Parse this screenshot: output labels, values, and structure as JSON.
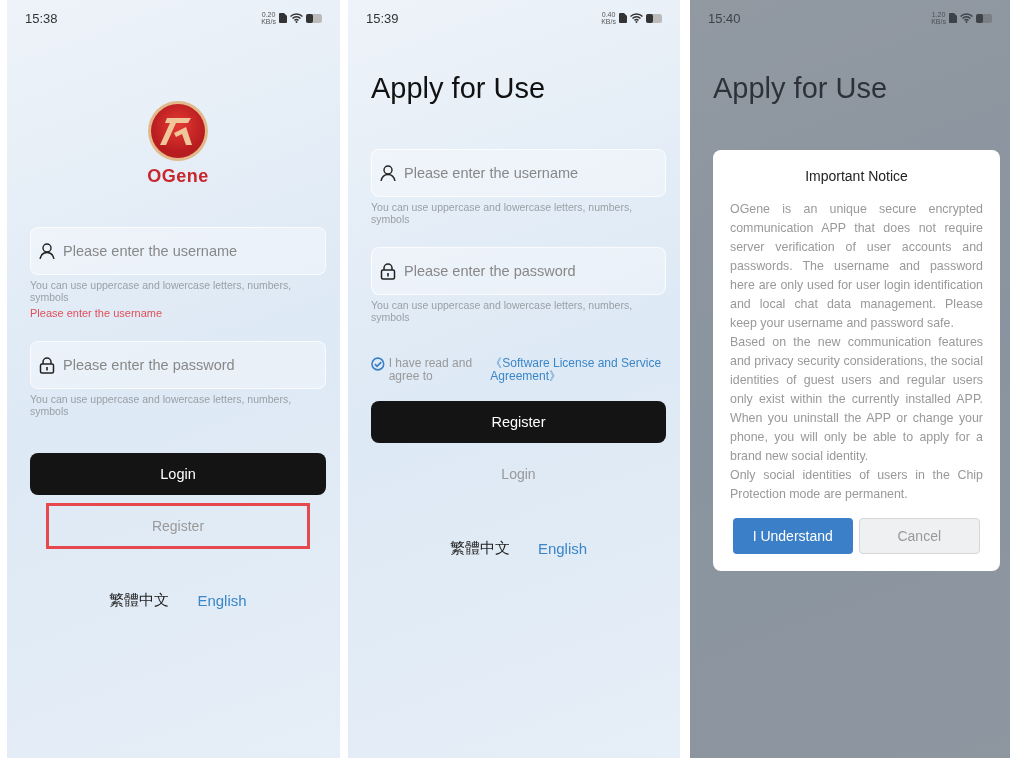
{
  "screens": [
    {
      "kind": "login",
      "status_bar": {
        "time": "15:38",
        "speed": "0.20",
        "speed_unit": "KB/s"
      },
      "logo_text": "OGene",
      "fields": [
        {
          "kind": "username",
          "placeholder": "Please enter the username",
          "hint": "You can use uppercase and lowercase letters, numbers, symbols",
          "error": "Please enter the username"
        },
        {
          "kind": "password",
          "placeholder": "Please enter the password",
          "hint": "You can use uppercase and lowercase letters, numbers, symbols"
        }
      ],
      "primary_button": "Login",
      "secondary_button": {
        "label": "Register",
        "highlighted": true
      },
      "languages": [
        {
          "label": "繁體中文",
          "selected": false
        },
        {
          "label": "English",
          "selected": true
        }
      ]
    },
    {
      "kind": "register",
      "status_bar": {
        "time": "15:39",
        "speed": "0.40",
        "speed_unit": "KB/s"
      },
      "title": "Apply for Use",
      "fields": [
        {
          "kind": "username",
          "placeholder": "Please enter the username",
          "hint": "You can use uppercase and lowercase letters, numbers, symbols"
        },
        {
          "kind": "password",
          "placeholder": "Please enter the password",
          "hint": "You can use uppercase and lowercase letters, numbers, symbols"
        }
      ],
      "agreement": {
        "checked": true,
        "text": "I have read and agree to",
        "link": "《Software License and Service Agreement》"
      },
      "primary_button": "Register",
      "secondary_button": {
        "label": "Login",
        "highlighted": false
      },
      "languages": [
        {
          "label": "繁體中文",
          "selected": false
        },
        {
          "label": "English",
          "selected": true
        }
      ]
    },
    {
      "kind": "notice",
      "status_bar": {
        "time": "15:40",
        "speed": "1.20",
        "speed_unit": "KB/s"
      },
      "title": "Apply for Use",
      "dialog": {
        "title": "Important Notice",
        "paragraphs": [
          "OGene is an unique secure encrypted communication APP that does not require server verification of user accounts and passwords. The username and password here are only used for user login identification and local chat data management. Please keep your username and password safe.",
          "Based on the new communication features and privacy security considerations, the social identities of guest users and regular users only exist within the currently installed APP. When you uninstall the APP or change your phone, you will only be able to apply for a brand new social identity.",
          "Only social identities of users in the Chip Protection mode are permanent."
        ],
        "buttons": [
          {
            "label": "I Understand",
            "kind": "primary"
          },
          {
            "label": "Cancel",
            "kind": "secondary"
          }
        ]
      }
    }
  ]
}
